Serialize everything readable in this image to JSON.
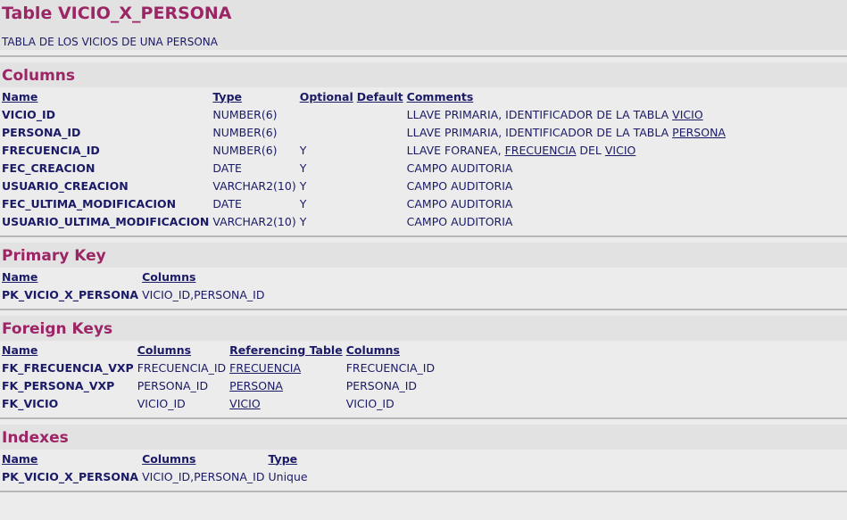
{
  "table_title": "Table VICIO_X_PERSONA",
  "table_description": "TABLA DE LOS VICIOS DE UNA PERSONA",
  "columns": {
    "heading": "Columns",
    "headers": {
      "name": "Name",
      "type": "Type",
      "optional": "Optional",
      "default": "Default",
      "comments": "Comments"
    },
    "rows": [
      {
        "name": "VICIO_ID",
        "type": "NUMBER(6)",
        "optional": "",
        "default": "",
        "comment_pre": "LLAVE PRIMARIA, IDENTIFICADOR DE LA TABLA ",
        "link1": "VICIO",
        "comment_mid": "",
        "link2": ""
      },
      {
        "name": "PERSONA_ID",
        "type": "NUMBER(6)",
        "optional": "",
        "default": "",
        "comment_pre": "LLAVE PRIMARIA, IDENTIFICADOR DE LA TABLA ",
        "link1": "PERSONA",
        "comment_mid": "",
        "link2": ""
      },
      {
        "name": "FRECUENCIA_ID",
        "type": "NUMBER(6)",
        "optional": "Y",
        "default": "",
        "comment_pre": "LLAVE FORANEA, ",
        "link1": "FRECUENCIA",
        "comment_mid": " DEL ",
        "link2": "VICIO"
      },
      {
        "name": "FEC_CREACION",
        "type": "DATE",
        "optional": "Y",
        "default": "",
        "comment_pre": "CAMPO AUDITORIA",
        "link1": "",
        "comment_mid": "",
        "link2": ""
      },
      {
        "name": "USUARIO_CREACION",
        "type": "VARCHAR2(10)",
        "optional": "Y",
        "default": "",
        "comment_pre": "CAMPO AUDITORIA",
        "link1": "",
        "comment_mid": "",
        "link2": ""
      },
      {
        "name": "FEC_ULTIMA_MODIFICACION",
        "type": "DATE",
        "optional": "Y",
        "default": "",
        "comment_pre": "CAMPO AUDITORIA",
        "link1": "",
        "comment_mid": "",
        "link2": ""
      },
      {
        "name": "USUARIO_ULTIMA_MODIFICACION",
        "type": "VARCHAR2(10)",
        "optional": "Y",
        "default": "",
        "comment_pre": "CAMPO AUDITORIA",
        "link1": "",
        "comment_mid": "",
        "link2": ""
      }
    ]
  },
  "primary_key": {
    "heading": "Primary Key",
    "headers": {
      "name": "Name",
      "columns": "Columns"
    },
    "rows": [
      {
        "name": "PK_VICIO_X_PERSONA",
        "columns": "VICIO_ID,PERSONA_ID"
      }
    ]
  },
  "foreign_keys": {
    "heading": "Foreign Keys",
    "headers": {
      "name": "Name",
      "columns": "Columns",
      "referencing_table": "Referencing Table",
      "ref_columns": "Columns"
    },
    "rows": [
      {
        "name": "FK_FRECUENCIA_VXP",
        "columns": "FRECUENCIA_ID",
        "referencing_table": "FRECUENCIA",
        "ref_columns": "FRECUENCIA_ID"
      },
      {
        "name": "FK_PERSONA_VXP",
        "columns": "PERSONA_ID",
        "referencing_table": "PERSONA",
        "ref_columns": "PERSONA_ID"
      },
      {
        "name": "FK_VICIO",
        "columns": "VICIO_ID",
        "referencing_table": "VICIO",
        "ref_columns": "VICIO_ID"
      }
    ]
  },
  "indexes": {
    "heading": "Indexes",
    "headers": {
      "name": "Name",
      "columns": "Columns",
      "type": "Type"
    },
    "rows": [
      {
        "name": "PK_VICIO_X_PERSONA",
        "columns": "VICIO_ID,PERSONA_ID",
        "type": "Unique"
      }
    ]
  }
}
